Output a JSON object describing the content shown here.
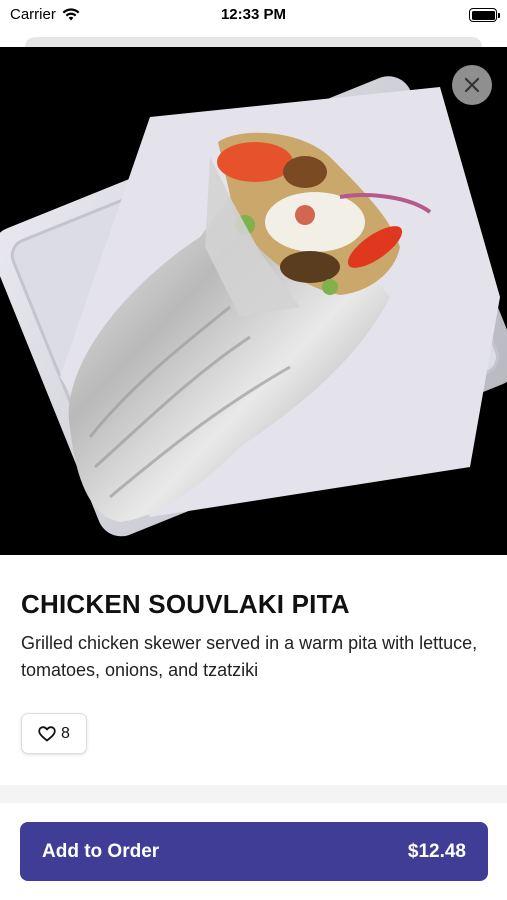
{
  "status_bar": {
    "carrier": "Carrier",
    "time": "12:33 PM"
  },
  "item": {
    "title": "CHICKEN SOUVLAKI PITA",
    "description": "Grilled chicken skewer served in a warm pita with lettuce, tomatoes, onions, and tzatziki",
    "likes": "8"
  },
  "order": {
    "button_label": "Add to Order",
    "price": "$12.48"
  },
  "colors": {
    "accent": "#3f3d96",
    "close_button": "#8f8f8f",
    "hero_background": "#000000"
  },
  "icons": {
    "close": "close-icon",
    "like": "heart-icon",
    "wifi": "wifi-icon",
    "battery": "battery-icon"
  }
}
